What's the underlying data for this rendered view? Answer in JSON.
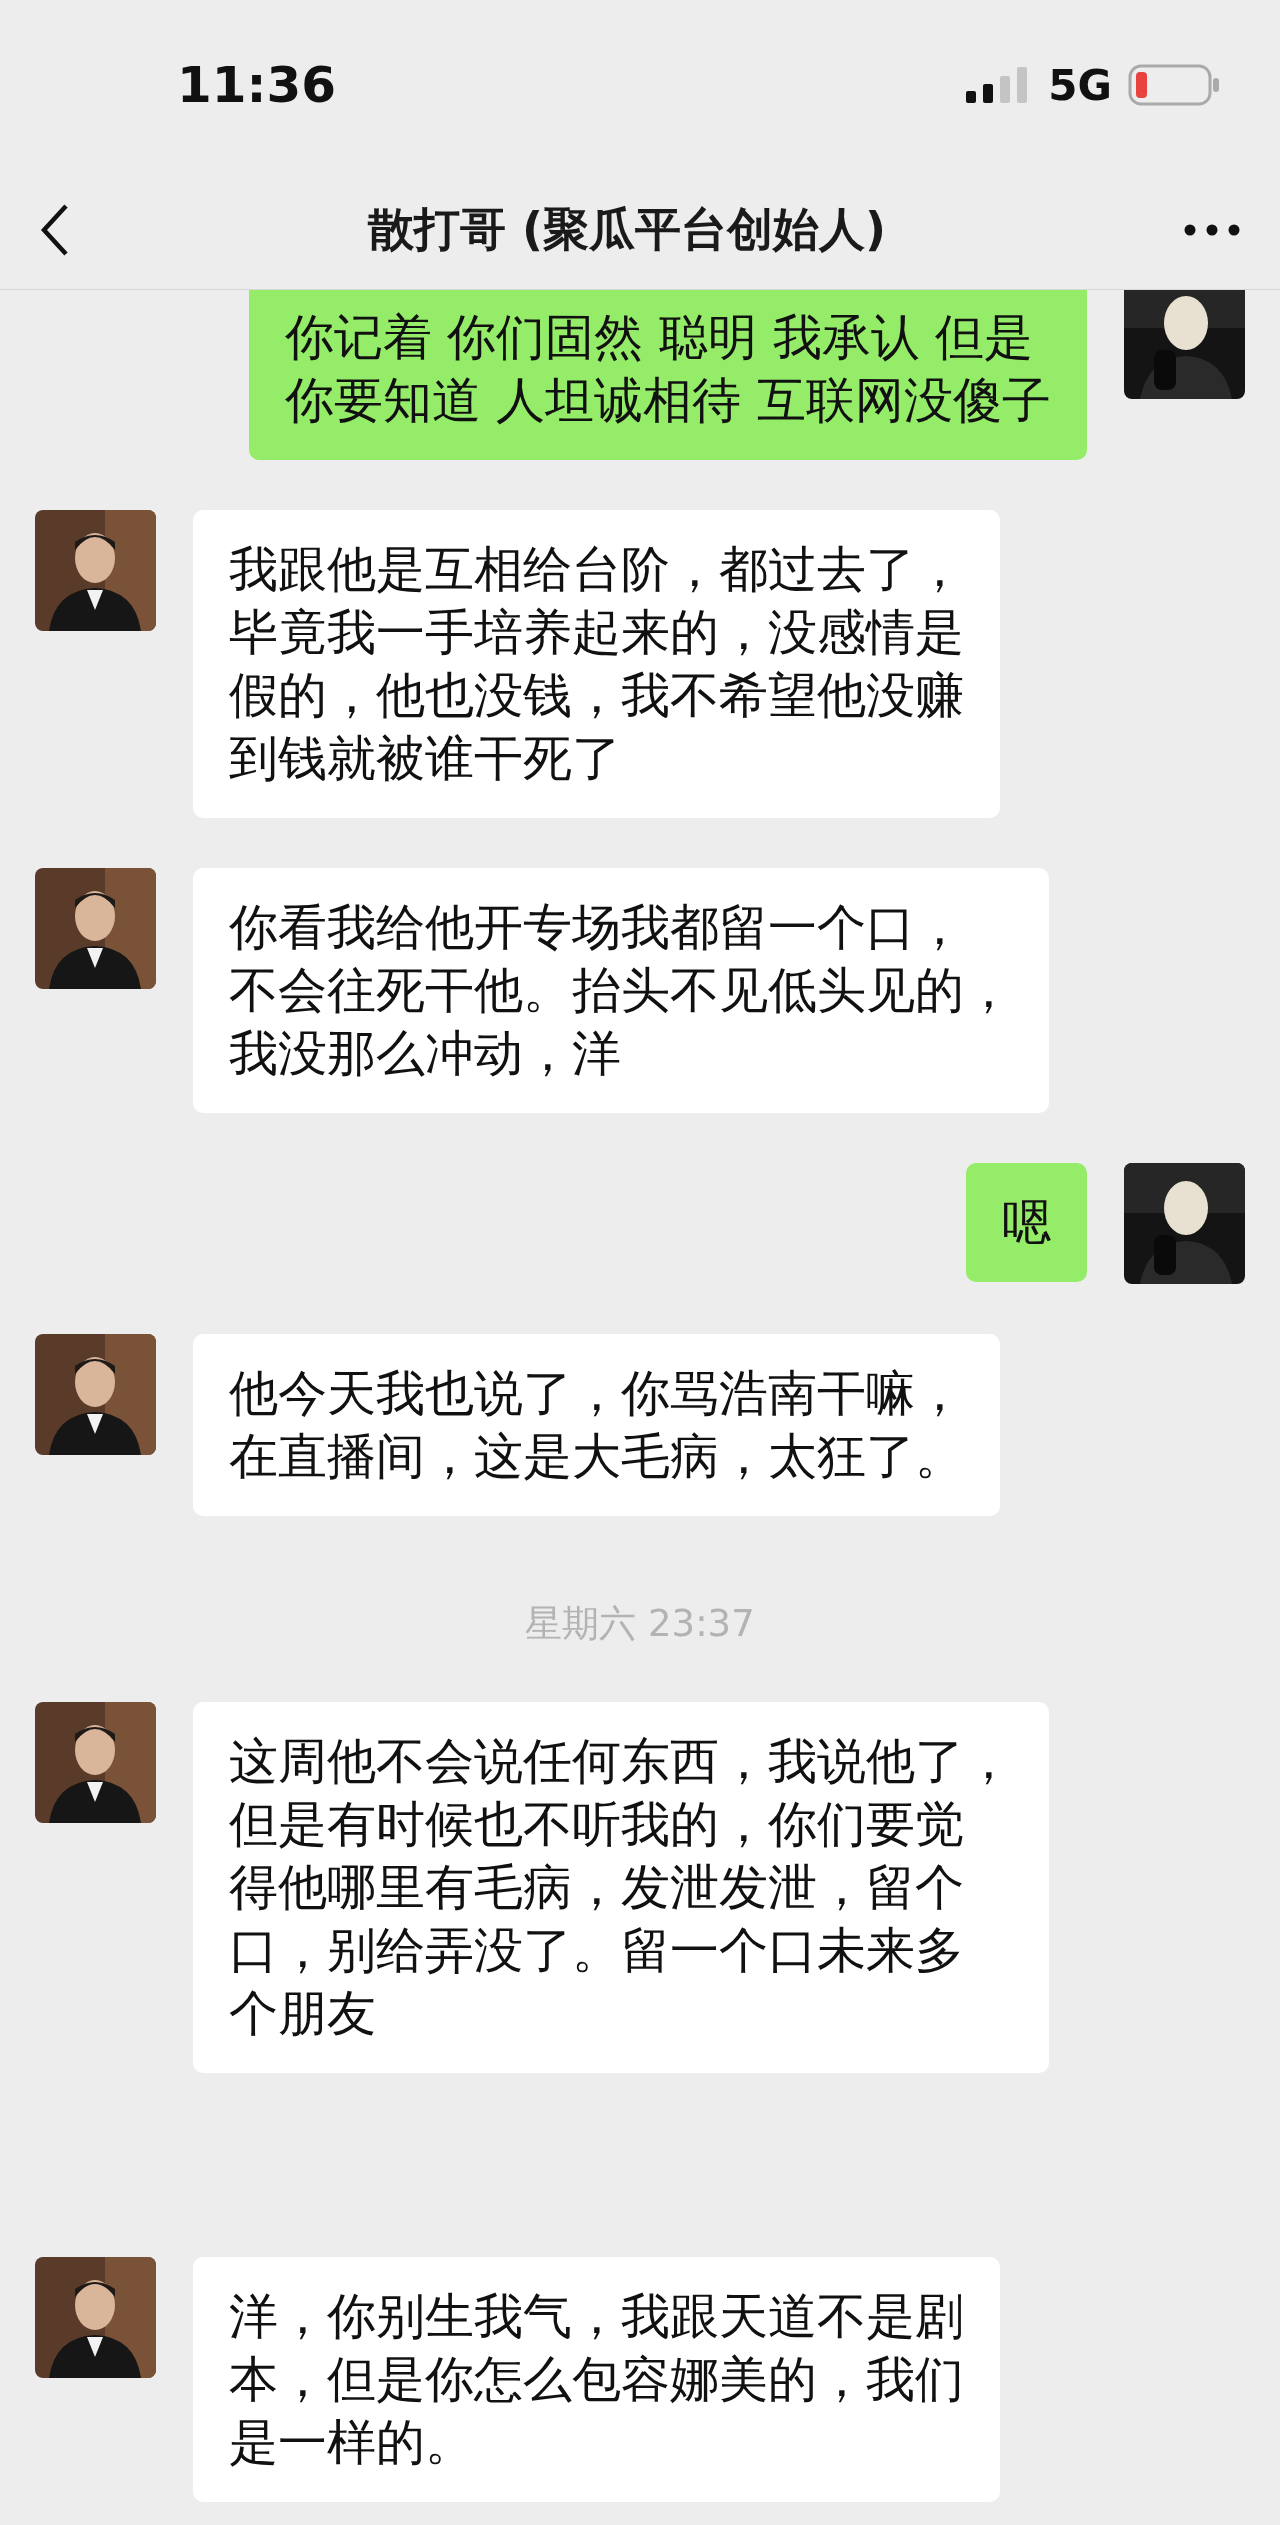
{
  "status_bar": {
    "time": "11:36",
    "network": "5G"
  },
  "header": {
    "title": "散打哥 (聚瓜平台创始人)"
  },
  "messages": [
    {
      "kind": "sent",
      "lines": [
        "你记着 你们固然 聪明 我承认 但是",
        "你要知道 人坦诚相待 互联网没傻子"
      ]
    },
    {
      "kind": "received",
      "lines": [
        "我跟他是互相给台阶，都过去了，",
        "毕竟我一手培养起来的，没感情是",
        "假的，他也没钱，我不希望他没赚",
        "到钱就被谁干死了"
      ]
    },
    {
      "kind": "received",
      "lines": [
        "你看我给他开专场我都留一个口，",
        "不会往死干他。抬头不见低头见的，",
        "我没那么冲动，洋"
      ]
    },
    {
      "kind": "sent",
      "lines": [
        "嗯"
      ]
    },
    {
      "kind": "received",
      "lines": [
        "他今天我也说了，你骂浩南干嘛，",
        "在直播间，这是大毛病，太狂了。"
      ]
    },
    {
      "kind": "time",
      "text": "星期六 23:37"
    },
    {
      "kind": "received",
      "lines": [
        "这周他不会说任何东西，我说他了，",
        "但是有时候也不听我的，你们要觉",
        "得他哪里有毛病，发泄发泄，留个",
        "口，别给弄没了。留一个口未来多",
        "个朋友"
      ]
    },
    {
      "kind": "received",
      "lines": [
        "洋，你别生我气，我跟天道不是剧",
        "本，但是你怎么包容娜美的，我们",
        "是一样的。"
      ]
    }
  ]
}
